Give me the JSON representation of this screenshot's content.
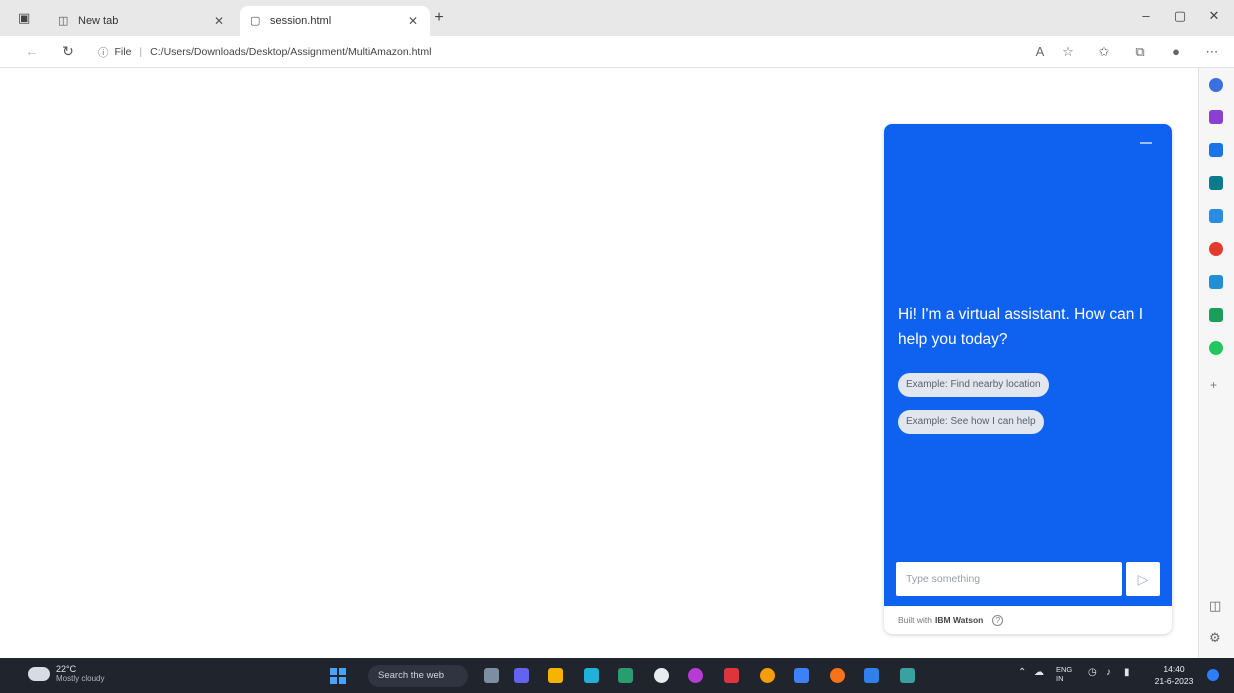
{
  "browser": {
    "tabs": [
      {
        "label": "New tab"
      },
      {
        "label": "session.html"
      }
    ],
    "address_bar": {
      "scheme_label": "File",
      "url": "C:/Users/Downloads/Desktop/Assignment/MultiAmazon.html"
    },
    "window_controls": {
      "minimize": "–",
      "restore": "▢",
      "close": "✕"
    }
  },
  "chat_widget": {
    "greeting": "Hi! I'm a virtual assistant. How can I help you today?",
    "suggestions": [
      "Example: Find nearby location",
      "Example: See how I can help"
    ],
    "input_placeholder": "Type something",
    "footer_prefix": "Built with",
    "footer_brand": "IBM Watson"
  },
  "taskbar": {
    "weather_temp": "22°C",
    "weather_condition": "Mostly cloudy",
    "search_label": "Search the web",
    "tray_lang": "ENG IN",
    "clock_time": "14:40",
    "clock_date": "21-6-2023"
  },
  "colors": {
    "chat_blue": "#0f62ef",
    "tabbar_bg": "#e8e8e8",
    "taskbar_bg": "#20242c"
  }
}
